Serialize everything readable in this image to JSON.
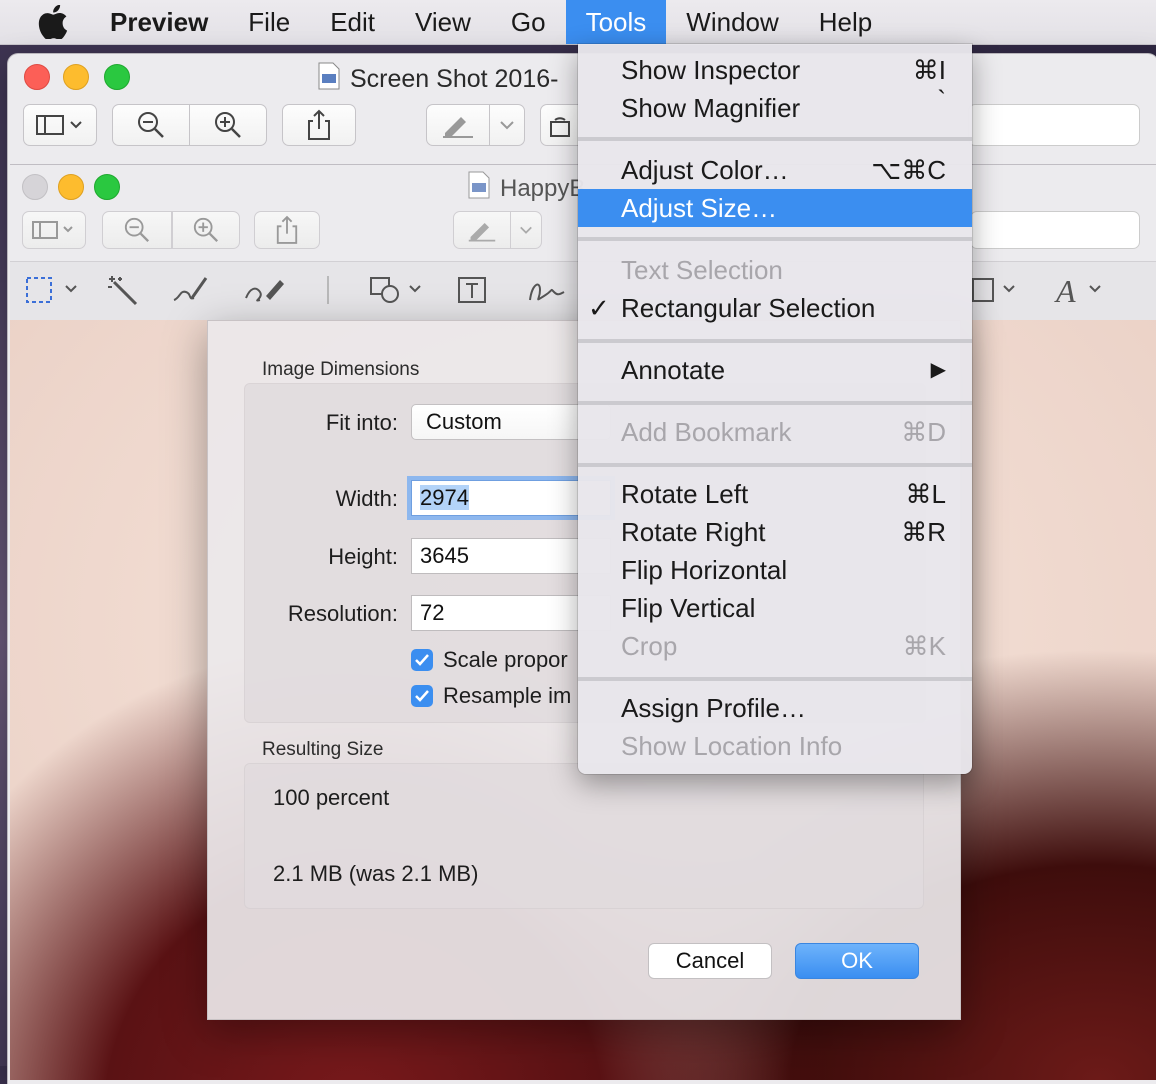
{
  "menubar": {
    "app": "Preview",
    "items": [
      "File",
      "Edit",
      "View",
      "Go",
      "Tools",
      "Window",
      "Help"
    ],
    "active": "Tools",
    "accent": "#3b8ef0"
  },
  "back_window": {
    "title": "Screen Shot 2016-"
  },
  "front_window": {
    "title": "HappyB"
  },
  "dialog": {
    "image_dimensions_label": "Image Dimensions",
    "fit_into_label": "Fit into:",
    "fit_into_value": "Custom",
    "width_label": "Width:",
    "width_value": "2974",
    "height_label": "Height:",
    "height_value": "3645",
    "resolution_label": "Resolution:",
    "resolution_value": "72",
    "scale_label": "Scale propor",
    "resample_label": "Resample im",
    "resulting_size_label": "Resulting Size",
    "percent_text": "100 percent",
    "size_text": "2.1 MB (was 2.1 MB)",
    "cancel_label": "Cancel",
    "ok_label": "OK"
  },
  "tools_menu": {
    "show_inspector": "Show Inspector",
    "show_inspector_sc": "⌘I",
    "show_magnifier": "Show Magnifier",
    "show_magnifier_sc": "`",
    "adjust_color": "Adjust Color…",
    "adjust_color_sc": "⌥⌘C",
    "adjust_size": "Adjust Size…",
    "text_selection": "Text Selection",
    "rect_selection": "Rectangular Selection",
    "checkmark": "✓",
    "annotate": "Annotate",
    "submenu_arrow": "▶",
    "add_bookmark": "Add Bookmark",
    "add_bookmark_sc": "⌘D",
    "rotate_left": "Rotate Left",
    "rotate_left_sc": "⌘L",
    "rotate_right": "Rotate Right",
    "rotate_right_sc": "⌘R",
    "flip_horizontal": "Flip Horizontal",
    "flip_vertical": "Flip Vertical",
    "crop": "Crop",
    "crop_sc": "⌘K",
    "assign_profile": "Assign Profile…",
    "show_location": "Show Location Info"
  }
}
